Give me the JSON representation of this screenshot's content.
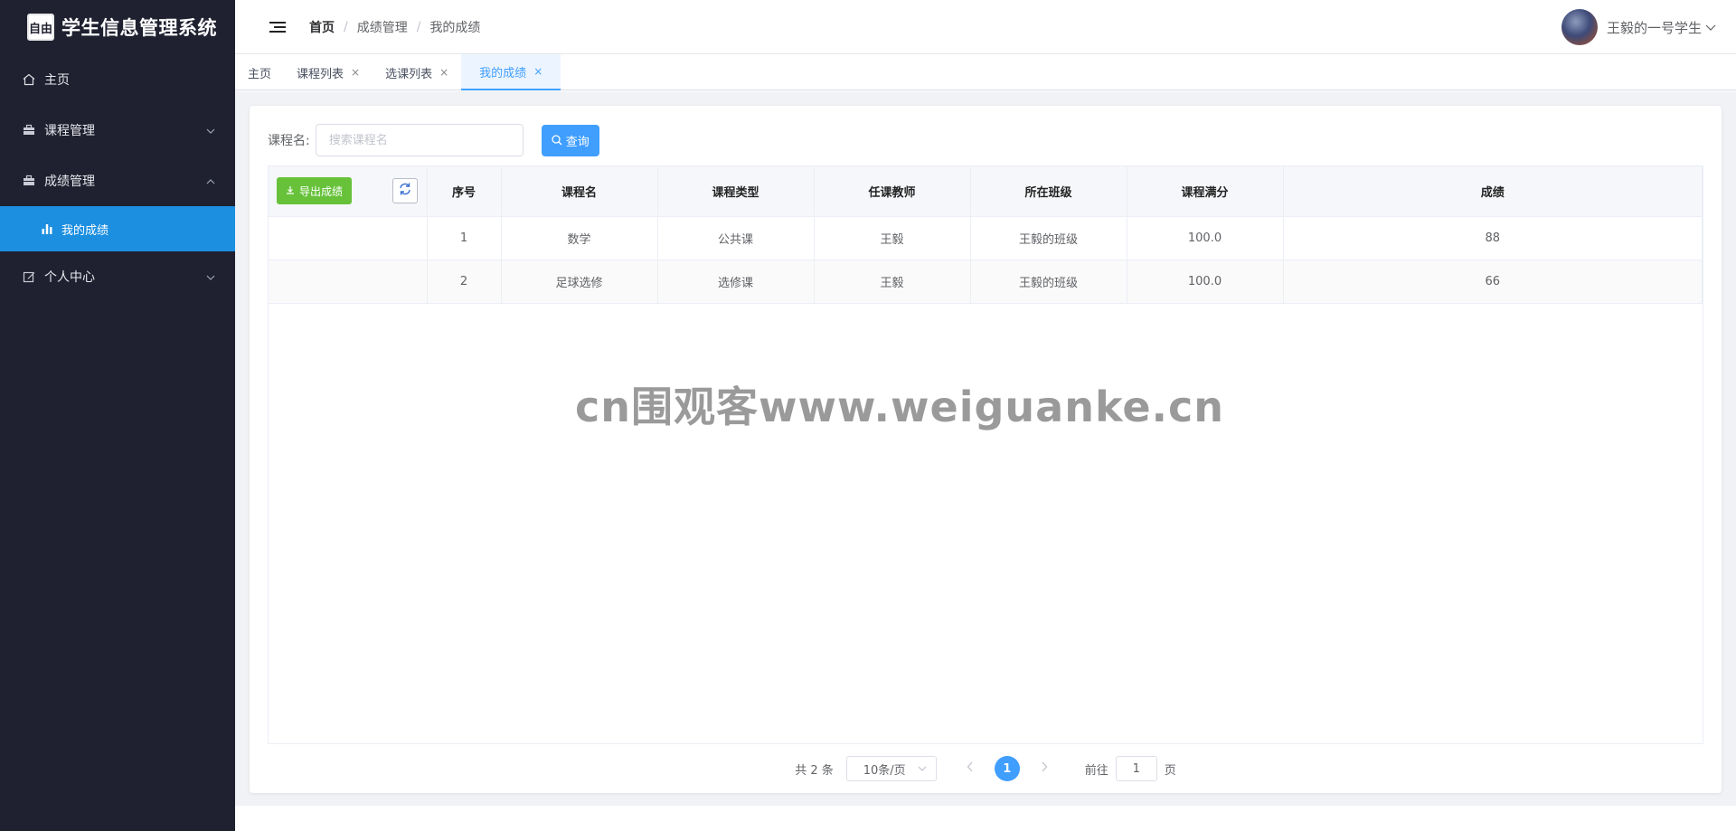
{
  "brand": {
    "logo_text": "自由",
    "title": "学生信息管理系统"
  },
  "sidebar": {
    "items": [
      {
        "label": "主页",
        "icon": "home-icon"
      },
      {
        "label": "课程管理",
        "icon": "briefcase-icon",
        "arrow": "chevron-down"
      },
      {
        "label": "成绩管理",
        "icon": "briefcase-icon",
        "arrow": "chevron-up"
      },
      {
        "label": "个人中心",
        "icon": "edit-icon",
        "arrow": "chevron-down"
      }
    ],
    "sub_item": {
      "label": "我的成绩",
      "icon": "bar-chart-icon"
    },
    "active_color": "#1c8fe0"
  },
  "header": {
    "breadcrumb": [
      "首页",
      "成绩管理",
      "我的成绩"
    ],
    "user_name": "王毅的一号学生"
  },
  "tabs": [
    {
      "label": "主页",
      "closable": false,
      "active": false
    },
    {
      "label": "课程列表",
      "closable": true,
      "active": false
    },
    {
      "label": "选课列表",
      "closable": true,
      "active": false
    },
    {
      "label": "我的成绩",
      "closable": true,
      "active": true
    }
  ],
  "search": {
    "label": "课程名:",
    "placeholder": "搜索课程名",
    "value": "",
    "query_button": "查询"
  },
  "toolbar": {
    "export_button": "导出成绩"
  },
  "table": {
    "columns": [
      "序号",
      "课程名",
      "课程类型",
      "任课教师",
      "所在班级",
      "课程满分",
      "成绩"
    ],
    "rows": [
      [
        "1",
        "数学",
        "公共课",
        "王毅",
        "王毅的班级",
        "100.0",
        "88"
      ],
      [
        "2",
        "足球选修",
        "选修课",
        "王毅",
        "王毅的班级",
        "100.0",
        "66"
      ]
    ]
  },
  "pagination": {
    "total": "共 2 条",
    "page_size": "10条/页",
    "current_page": "1",
    "goto_prefix": "前往",
    "goto_value": "1",
    "goto_suffix": "页"
  },
  "watermark": "cn围观客www.weiguanke.cn",
  "colors": {
    "primary": "#409eff",
    "success": "#67c23a",
    "sidebar_bg": "#1f2130"
  }
}
